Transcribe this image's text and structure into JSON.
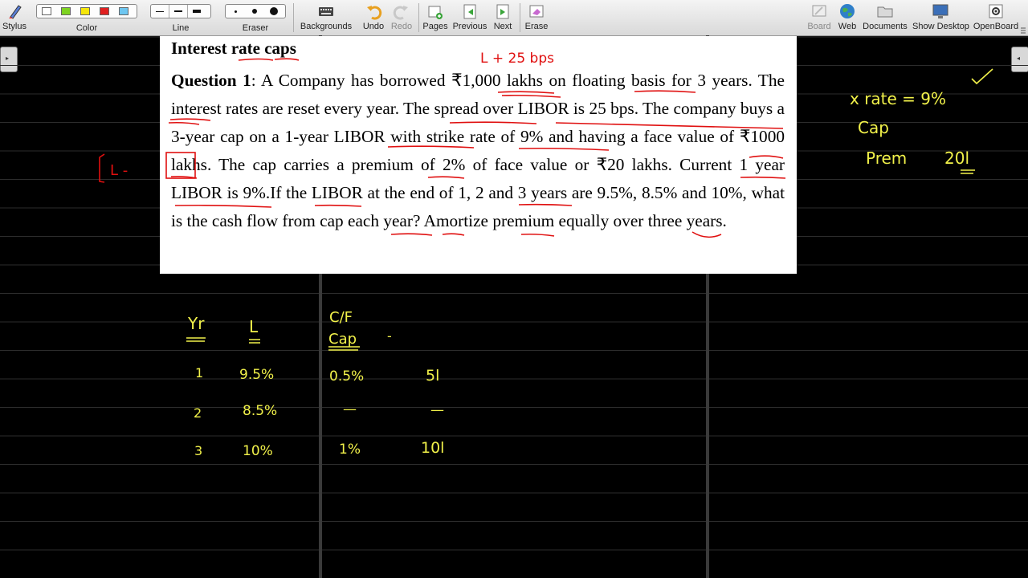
{
  "toolbar": {
    "stylus": "Stylus",
    "color": "Color",
    "line": "Line",
    "eraser": "Eraser",
    "backgrounds": "Backgrounds",
    "undo": "Undo",
    "redo": "Redo",
    "pages": "Pages",
    "previous": "Previous",
    "next": "Next",
    "erase": "Erase",
    "board": "Board",
    "web": "Web",
    "documents": "Documents",
    "show_desktop": "Show Desktop",
    "openboard": "OpenBoard",
    "colors": [
      "#ffffff",
      "#7ed321",
      "#f5e60a",
      "#e02020",
      "#6ec6f0"
    ]
  },
  "document": {
    "title": "Interest rate caps",
    "question_label": "Question 1",
    "question_text": ": A Company has borrowed ₹1,000 lakhs on floating basis for 3 years. The interest rates are reset every year. The spread over LIBOR is 25 bps. The company buys a 3-year cap on a 1-year LIBOR with strike rate of 9% and having a face value of ₹1000 lakhs. The cap carries a premium of 2% of face value or ₹20 lakhs. Current 1 year LIBOR is 9%.If the LIBOR at the end of 1, 2 and 3 years are 9.5%, 8.5% and 10%, what is the cash flow from cap each year? Amortize premium equally over three years."
  },
  "annotations": {
    "red_top": "L + 25  bps",
    "red_left": "L -",
    "notes": [
      "x rate = 9%",
      "Cap",
      "Prem",
      "20l"
    ],
    "table_headers": [
      "Yr",
      "L",
      "C/F",
      "Cap",
      "-"
    ],
    "rows": [
      [
        "1",
        "9.5%",
        "0.5%",
        "5l"
      ],
      [
        "2",
        "8.5%",
        "—",
        "—"
      ],
      [
        "3",
        "10%",
        "1%",
        "10l"
      ]
    ]
  }
}
